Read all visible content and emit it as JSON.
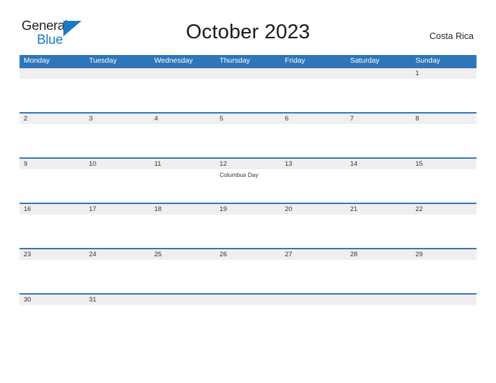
{
  "brand": {
    "name_part1": "General",
    "name_part2": "Blue",
    "flag_icon": "triangle-flag-icon",
    "accent_color": "#1b79c4"
  },
  "header": {
    "title": "October 2023",
    "region": "Costa Rica"
  },
  "calendar": {
    "header_bg": "#2e76b8",
    "daynum_bg": "#efefef",
    "weekday_headers": [
      "Monday",
      "Tuesday",
      "Wednesday",
      "Thursday",
      "Friday",
      "Saturday",
      "Sunday"
    ],
    "weeks": [
      {
        "days": [
          {
            "num": "",
            "events": []
          },
          {
            "num": "",
            "events": []
          },
          {
            "num": "",
            "events": []
          },
          {
            "num": "",
            "events": []
          },
          {
            "num": "",
            "events": []
          },
          {
            "num": "",
            "events": []
          },
          {
            "num": "1",
            "events": []
          }
        ]
      },
      {
        "days": [
          {
            "num": "2",
            "events": []
          },
          {
            "num": "3",
            "events": []
          },
          {
            "num": "4",
            "events": []
          },
          {
            "num": "5",
            "events": []
          },
          {
            "num": "6",
            "events": []
          },
          {
            "num": "7",
            "events": []
          },
          {
            "num": "8",
            "events": []
          }
        ]
      },
      {
        "days": [
          {
            "num": "9",
            "events": []
          },
          {
            "num": "10",
            "events": []
          },
          {
            "num": "11",
            "events": []
          },
          {
            "num": "12",
            "events": [
              "Columbus Day"
            ]
          },
          {
            "num": "13",
            "events": []
          },
          {
            "num": "14",
            "events": []
          },
          {
            "num": "15",
            "events": []
          }
        ]
      },
      {
        "days": [
          {
            "num": "16",
            "events": []
          },
          {
            "num": "17",
            "events": []
          },
          {
            "num": "18",
            "events": []
          },
          {
            "num": "19",
            "events": []
          },
          {
            "num": "20",
            "events": []
          },
          {
            "num": "21",
            "events": []
          },
          {
            "num": "22",
            "events": []
          }
        ]
      },
      {
        "days": [
          {
            "num": "23",
            "events": []
          },
          {
            "num": "24",
            "events": []
          },
          {
            "num": "25",
            "events": []
          },
          {
            "num": "26",
            "events": []
          },
          {
            "num": "27",
            "events": []
          },
          {
            "num": "28",
            "events": []
          },
          {
            "num": "29",
            "events": []
          }
        ]
      },
      {
        "days": [
          {
            "num": "30",
            "events": []
          },
          {
            "num": "31",
            "events": []
          },
          {
            "num": "",
            "events": []
          },
          {
            "num": "",
            "events": []
          },
          {
            "num": "",
            "events": []
          },
          {
            "num": "",
            "events": []
          },
          {
            "num": "",
            "events": []
          }
        ]
      }
    ]
  }
}
